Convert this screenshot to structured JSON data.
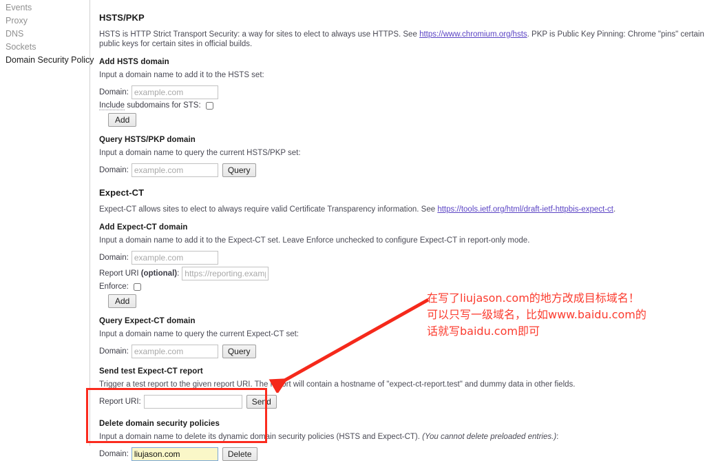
{
  "sidebar": {
    "items": [
      {
        "label": "Events",
        "selected": false
      },
      {
        "label": "Proxy",
        "selected": false
      },
      {
        "label": "DNS",
        "selected": false
      },
      {
        "label": "Sockets",
        "selected": false
      },
      {
        "label": "Domain Security Policy",
        "selected": true
      }
    ]
  },
  "hsts": {
    "title": "HSTS/PKP",
    "desc_before_link": "HSTS is HTTP Strict Transport Security: a way for sites to elect to always use HTTPS. See ",
    "link_text": "https://www.chromium.org/hsts",
    "desc_after_link": ". PKP is Public Key Pinning: Chrome \"pins\" certain public keys for certain sites in official builds.",
    "add": {
      "title": "Add HSTS domain",
      "desc": "Input a domain name to add it to the HSTS set:",
      "domain_label": "Domain:",
      "domain_value": "",
      "domain_placeholder": "example.com",
      "subdomains_label_abbr": "Include",
      "subdomains_label_rest": " subdomains for STS:",
      "subdomains_checked": false,
      "add_button": "Add"
    },
    "query": {
      "title": "Query HSTS/PKP domain",
      "desc": "Input a domain name to query the current HSTS/PKP set:",
      "domain_label": "Domain:",
      "domain_value": "",
      "domain_placeholder": "example.com",
      "query_button": "Query"
    }
  },
  "expect_ct": {
    "title": "Expect-CT",
    "desc_before_link": "Expect-CT allows sites to elect to always require valid Certificate Transparency information. See ",
    "link_text": "https://tools.ietf.org/html/draft-ietf-httpbis-expect-ct",
    "desc_after_link": ".",
    "add": {
      "title": "Add Expect-CT domain",
      "desc": "Input a domain name to add it to the Expect-CT set. Leave Enforce unchecked to configure Expect-CT in report-only mode.",
      "domain_label": "Domain:",
      "domain_value": "",
      "domain_placeholder": "example.com",
      "report_uri_label_plain": "Report URI ",
      "report_uri_label_bold": "(optional)",
      "report_uri_label_colon": ":",
      "report_uri_value": "",
      "report_uri_placeholder": "https://reporting.example.c",
      "enforce_label": "Enforce:",
      "enforce_checked": false,
      "add_button": "Add"
    },
    "query": {
      "title": "Query Expect-CT domain",
      "desc": "Input a domain name to query the current Expect-CT set:",
      "domain_label": "Domain:",
      "domain_value": "",
      "domain_placeholder": "example.com",
      "query_button": "Query"
    },
    "send_report": {
      "title": "Send test Expect-CT report",
      "desc": "Trigger a test report to the given report URI. The report will contain a hostname of \"expect-ct-report.test\" and dummy data in other fields.",
      "report_uri_label": "Report URI:",
      "report_uri_value": "",
      "send_button": "Send"
    }
  },
  "delete_section": {
    "title": "Delete domain security policies",
    "desc_normal": "Input a domain name to delete its dynamic domain security policies (HSTS and Expect-CT). ",
    "desc_italic": "(You cannot delete preloaded entries.)",
    "desc_tail": ":",
    "domain_label": "Domain:",
    "domain_value": "liujason.com",
    "delete_button": "Delete"
  },
  "annotation": {
    "text": "在写了liujason.com的地方改成目标域名！\n可以只写一级域名，比如www.baidu.com的\n话就写baidu.com即可",
    "color": "#fb3b2e",
    "box_color": "#fb2b1e"
  }
}
